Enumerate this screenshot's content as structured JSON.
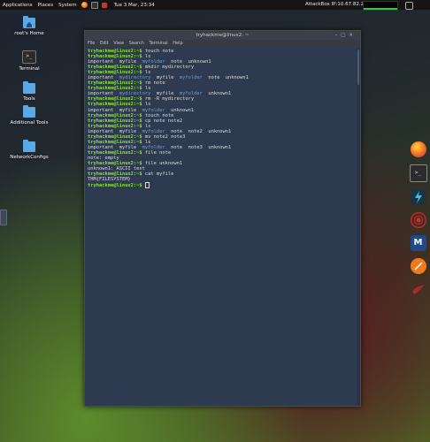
{
  "topbar": {
    "applications": "Applications",
    "places": "Places",
    "system": "System",
    "datetime": "Tue 3 Mar, 23:34",
    "ip": "AttackBox IP:10.67.82.204"
  },
  "desktop": {
    "icons": [
      {
        "label": "root's Home",
        "icon": "home-folder-icon"
      },
      {
        "label": "Terminal",
        "icon": "terminal-icon"
      },
      {
        "label": "Tools",
        "icon": "folder-icon"
      },
      {
        "label": "Additional Tools",
        "icon": "folder-icon"
      },
      {
        "label": "NetworkConfigs",
        "icon": "folder-icon"
      }
    ]
  },
  "terminal": {
    "title": "tryhackme@linux2: ~",
    "menu": [
      "File",
      "Edit",
      "View",
      "Search",
      "Terminal",
      "Help"
    ],
    "prompt": "tryhackme@linux2",
    "lines": [
      {
        "t": "cmd",
        "cmd": "touch note"
      },
      {
        "t": "cmd",
        "cmd": "ls"
      },
      {
        "t": "out",
        "parts": [
          [
            "important  myfile  ",
            ""
          ],
          [
            "myfolder",
            "dir"
          ],
          [
            "  note  unknown1",
            ""
          ]
        ]
      },
      {
        "t": "cmd",
        "cmd": "mkdir mydirectory"
      },
      {
        "t": "cmd",
        "cmd": "ls"
      },
      {
        "t": "out",
        "parts": [
          [
            "important  ",
            ""
          ],
          [
            "mydirectory",
            "dir"
          ],
          [
            "  myfile  ",
            ""
          ],
          [
            "myfolder",
            "dir"
          ],
          [
            "  note  unknown1",
            ""
          ]
        ]
      },
      {
        "t": "cmd",
        "cmd": "rm note"
      },
      {
        "t": "cmd",
        "cmd": "ls"
      },
      {
        "t": "out",
        "parts": [
          [
            "important  ",
            ""
          ],
          [
            "mydirectory",
            "dir"
          ],
          [
            "  myfile  ",
            ""
          ],
          [
            "myfolder",
            "dir"
          ],
          [
            "  unknown1",
            ""
          ]
        ]
      },
      {
        "t": "cmd",
        "cmd": "rm -R mydirectory"
      },
      {
        "t": "cmd",
        "cmd": "ls"
      },
      {
        "t": "out",
        "parts": [
          [
            "important  myfile  ",
            ""
          ],
          [
            "myfolder",
            "dir"
          ],
          [
            "  unknown1",
            ""
          ]
        ]
      },
      {
        "t": "cmd",
        "cmd": "touch note"
      },
      {
        "t": "cmd",
        "cmd": "cp note note2"
      },
      {
        "t": "cmd",
        "cmd": "ls"
      },
      {
        "t": "out",
        "parts": [
          [
            "important  myfile  ",
            ""
          ],
          [
            "myfolder",
            "dir"
          ],
          [
            "  note  note2  unknown1",
            ""
          ]
        ]
      },
      {
        "t": "cmd",
        "cmd": "mv note2 note3"
      },
      {
        "t": "cmd",
        "cmd": "ls"
      },
      {
        "t": "out",
        "parts": [
          [
            "important  myfile  ",
            ""
          ],
          [
            "myfolder",
            "dir"
          ],
          [
            "  note  note3  unknown1",
            ""
          ]
        ]
      },
      {
        "t": "cmd",
        "cmd": "file note"
      },
      {
        "t": "out",
        "parts": [
          [
            "note: empty",
            ""
          ]
        ]
      },
      {
        "t": "cmd",
        "cmd": "file unknown1"
      },
      {
        "t": "out",
        "parts": [
          [
            "unknown1: ASCII text",
            ""
          ]
        ]
      },
      {
        "t": "cmd",
        "cmd": "cat myfile"
      },
      {
        "t": "out",
        "parts": [
          [
            "THM{FILESYSTEM}",
            ""
          ]
        ]
      },
      {
        "t": "cur",
        "cmd": ""
      }
    ]
  },
  "dock": [
    "firefox-icon",
    "terminal-icon",
    "burp-icon",
    "target-icon",
    "metasploit-icon",
    "zap-icon",
    "bird-icon"
  ],
  "colors": {
    "prompt": "#8ae234",
    "directory": "#729fcf",
    "terminal_bg": "#2e3a4f"
  }
}
